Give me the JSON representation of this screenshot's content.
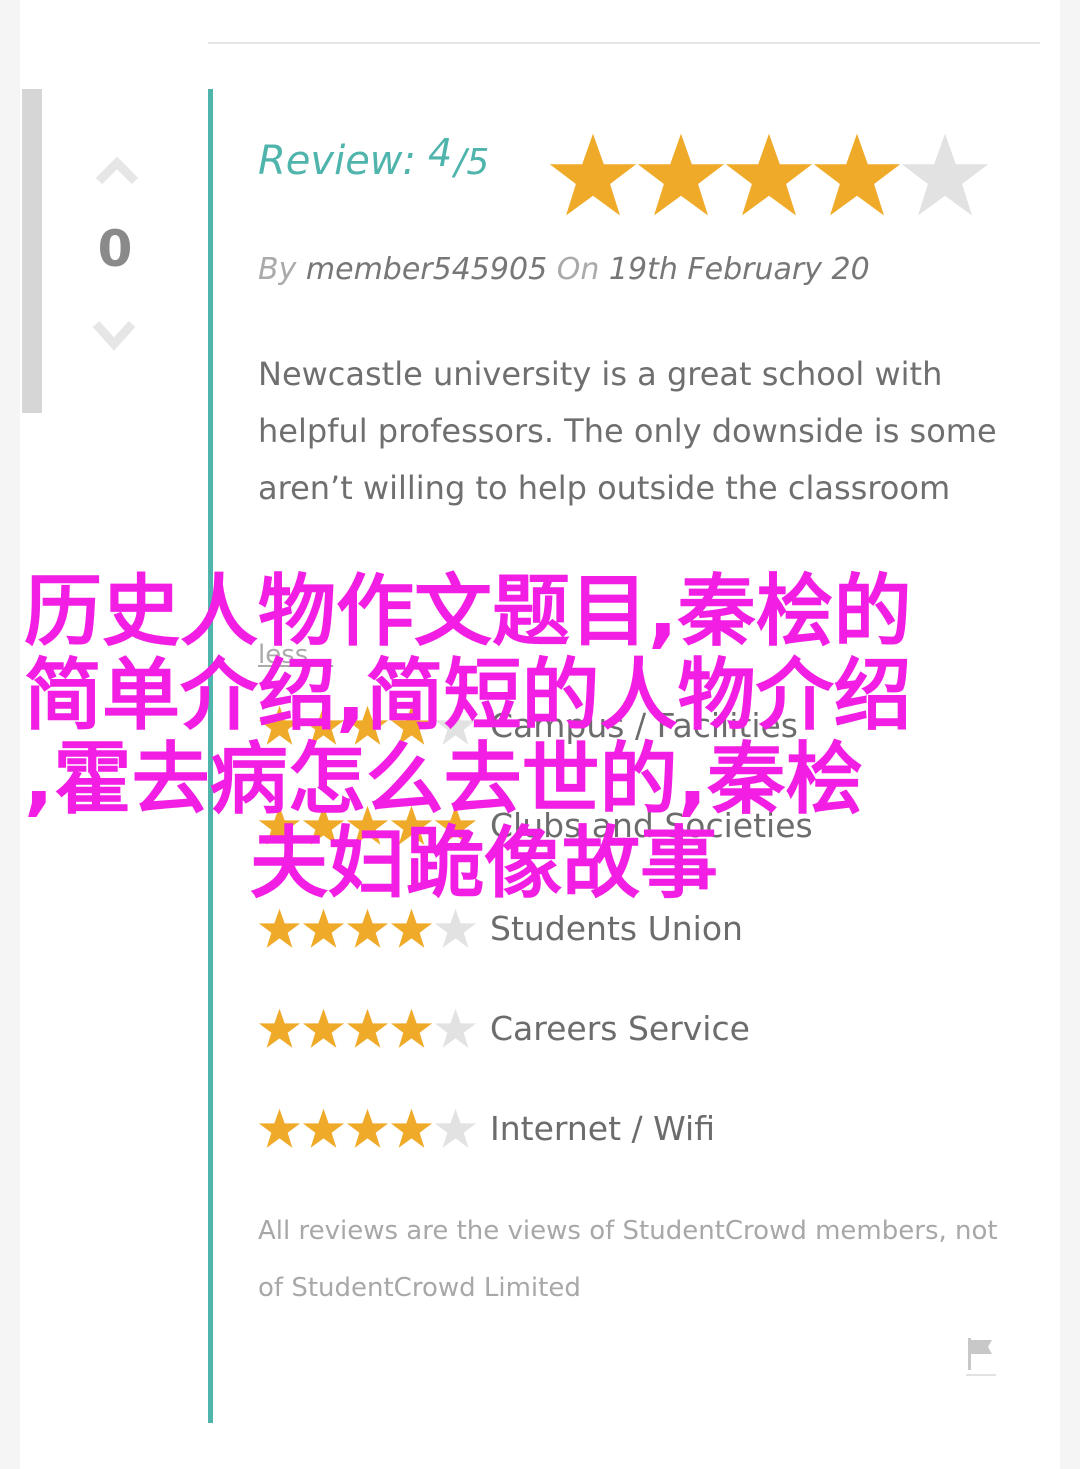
{
  "vote": {
    "count": "0"
  },
  "review": {
    "label": "Review:",
    "score": "4",
    "out_of": "/5",
    "rating": 4,
    "max_rating": 5,
    "by_label": "By",
    "author": "member545905",
    "on_label": "On",
    "date": "19th February 20",
    "text": "Newcastle university is a great school with helpful professors. The only downside is some aren’t willing to help outside the classroom",
    "less_link": "less..."
  },
  "categories": [
    {
      "name": "Campus / Facilities",
      "rating": 4
    },
    {
      "name": "Clubs and Societies",
      "rating": 5
    },
    {
      "name": "Students Union",
      "rating": 4
    },
    {
      "name": "Careers Service",
      "rating": 4
    },
    {
      "name": "Internet / Wifi",
      "rating": 4
    }
  ],
  "disclaimer": "All reviews are the views of StudentCrowd members, not of StudentCrowd Limited",
  "overlay": {
    "line1": "历史人物作文题目,秦桧的",
    "line2": "简单介绍,简短的人物介绍",
    "line3": ",霍去病怎么去世的,秦桧",
    "line4": "夫妇跪像故事"
  },
  "colors": {
    "teal": "#4fb4ac",
    "star_filled": "#f0aa2a",
    "star_empty": "#e2e2e2",
    "overlay": "#f21ee3"
  },
  "icons": {
    "upvote": "chevron-up-icon",
    "downvote": "chevron-down-icon",
    "flag": "flag-icon",
    "star": "star-icon"
  }
}
